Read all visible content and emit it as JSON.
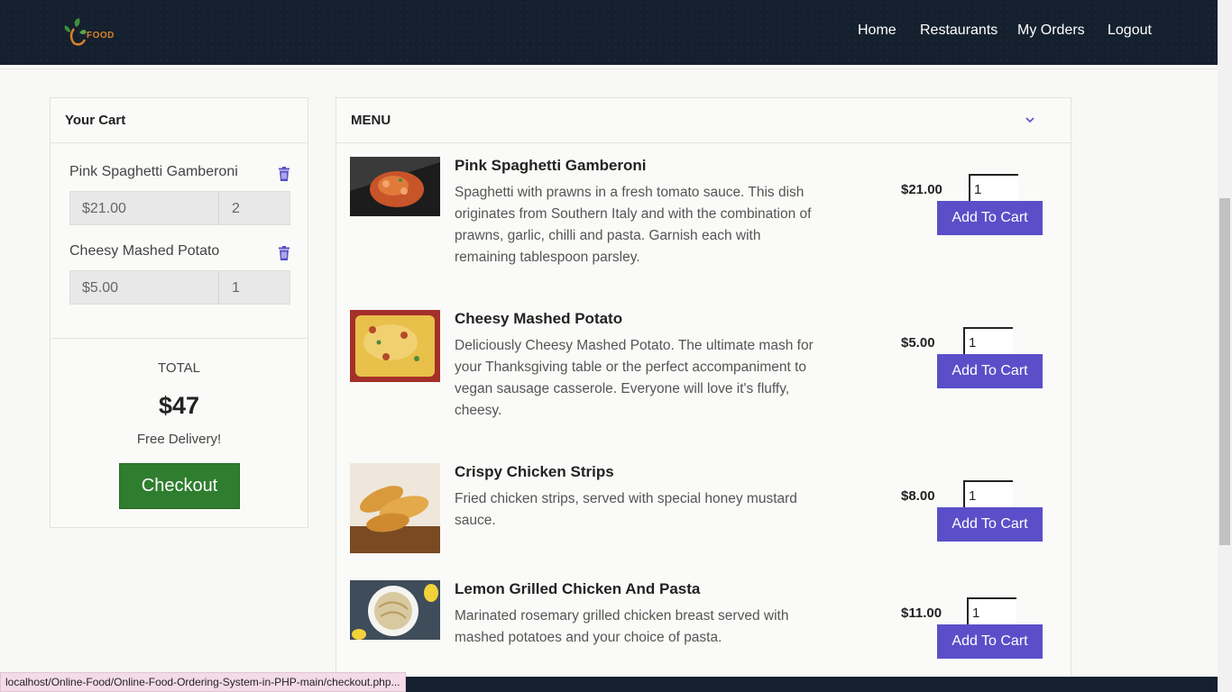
{
  "brand": {
    "logo_text": "FOOD"
  },
  "nav": {
    "items": [
      "Home",
      "Restaurants",
      "My Orders",
      "Logout"
    ]
  },
  "cart": {
    "title": "Your Cart",
    "items": [
      {
        "name": "Pink Spaghetti Gamberoni",
        "price": "$21.00",
        "qty": "2"
      },
      {
        "name": "Cheesy Mashed Potato",
        "price": "$5.00",
        "qty": "1"
      }
    ],
    "total_label": "TOTAL",
    "total": "$47",
    "delivery": "Free Delivery!",
    "checkout_label": "Checkout"
  },
  "menu": {
    "title": "MENU",
    "items": [
      {
        "title": "Pink Spaghetti Gamberoni",
        "description": "Spaghetti with prawns in a fresh tomato sauce. This dish originates from Southern Italy and with the combination of prawns, garlic, chilli and pasta. Garnish each with remaining tablespoon parsley.",
        "price": "$21.00",
        "qty": "1",
        "button": "Add To Cart"
      },
      {
        "title": "Cheesy Mashed Potato",
        "description": "Deliciously Cheesy Mashed Potato. The ultimate mash for your Thanksgiving table or the perfect accompaniment to vegan sausage casserole. Everyone will love it's fluffy, cheesy.",
        "price": "$5.00",
        "qty": "1",
        "button": "Add To Cart"
      },
      {
        "title": "Crispy Chicken Strips",
        "description": "Fried chicken strips, served with special honey mustard sauce.",
        "price": "$8.00",
        "qty": "1",
        "button": "Add To Cart"
      },
      {
        "title": "Lemon Grilled Chicken And Pasta",
        "description": "Marinated rosemary grilled chicken breast served with mashed potatoes and your choice of pasta.",
        "price": "$11.00",
        "qty": "1",
        "button": "Add To Cart"
      }
    ]
  },
  "status_bar": {
    "url": "localhost/Online-Food/Online-Food-Ordering-System-in-PHP-main/checkout.php..."
  },
  "colors": {
    "navbar": "#14202e",
    "accent": "#5a4fc8",
    "checkout": "#2f7d2f",
    "logo": "#d9822b"
  }
}
